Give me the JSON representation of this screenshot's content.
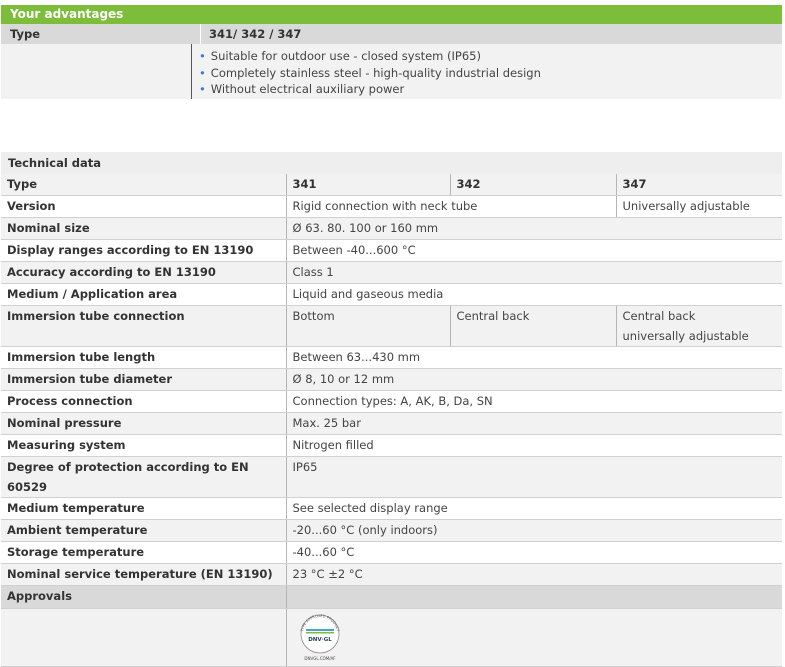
{
  "advantages": {
    "header": "Your advantages",
    "type_label": "Type",
    "type_value": "341/ 342 / 347",
    "items": [
      "Suitable for outdoor use - closed system (IP65)",
      "Completely stainless steel - high-quality industrial design",
      "Without electrical auxiliary power"
    ]
  },
  "technical": {
    "title": "Technical data",
    "rows": [
      {
        "label": "Type",
        "c1": "341",
        "c2": "342",
        "c3": "347"
      },
      {
        "label": "Version",
        "c12": "Rigid connection with neck tube",
        "c3": "Universally adjustable"
      },
      {
        "label": "Nominal size",
        "all": "Ø 63. 80. 100 or 160 mm"
      },
      {
        "label": "Display ranges according to EN 13190",
        "all": "Between -40...600 °C"
      },
      {
        "label": "Accuracy according to EN 13190",
        "all": "Class 1"
      },
      {
        "label": "Medium / Application area",
        "all": "Liquid and gaseous media"
      },
      {
        "label": "Immersion tube connection",
        "c1": "Bottom",
        "c2": "Central back",
        "c3a": "Central back",
        "c3b": "universally adjustable"
      },
      {
        "label": "Immersion tube length",
        "all": "Between 63...430 mm"
      },
      {
        "label": "Immersion tube diameter",
        "all": "Ø 8, 10 or 12 mm"
      },
      {
        "label": "Process connection",
        "all": "Connection types: A, AK, B, Da, SN"
      },
      {
        "label": "Nominal pressure",
        "all": "Max. 25 bar"
      },
      {
        "label": "Measuring system",
        "all": "Nitrogen filled"
      },
      {
        "label": "Degree of protection according to EN 60529",
        "all": "IP65"
      },
      {
        "label": "Medium temperature",
        "all": "See selected display range"
      },
      {
        "label": "Ambient temperature",
        "all": "-20...60 °C (only indoors)"
      },
      {
        "label": "Storage temperature",
        "all": "-40...60 °C"
      },
      {
        "label": "Nominal service temperature (EN 13190)",
        "all": "23 °C ±2 °C"
      }
    ],
    "approvals_label": "Approvals",
    "logo": {
      "arc_text": "TYPE APPROVED PRODUCT",
      "brand": "DNV·GL",
      "url": "DNVGL.COM/AF"
    }
  }
}
